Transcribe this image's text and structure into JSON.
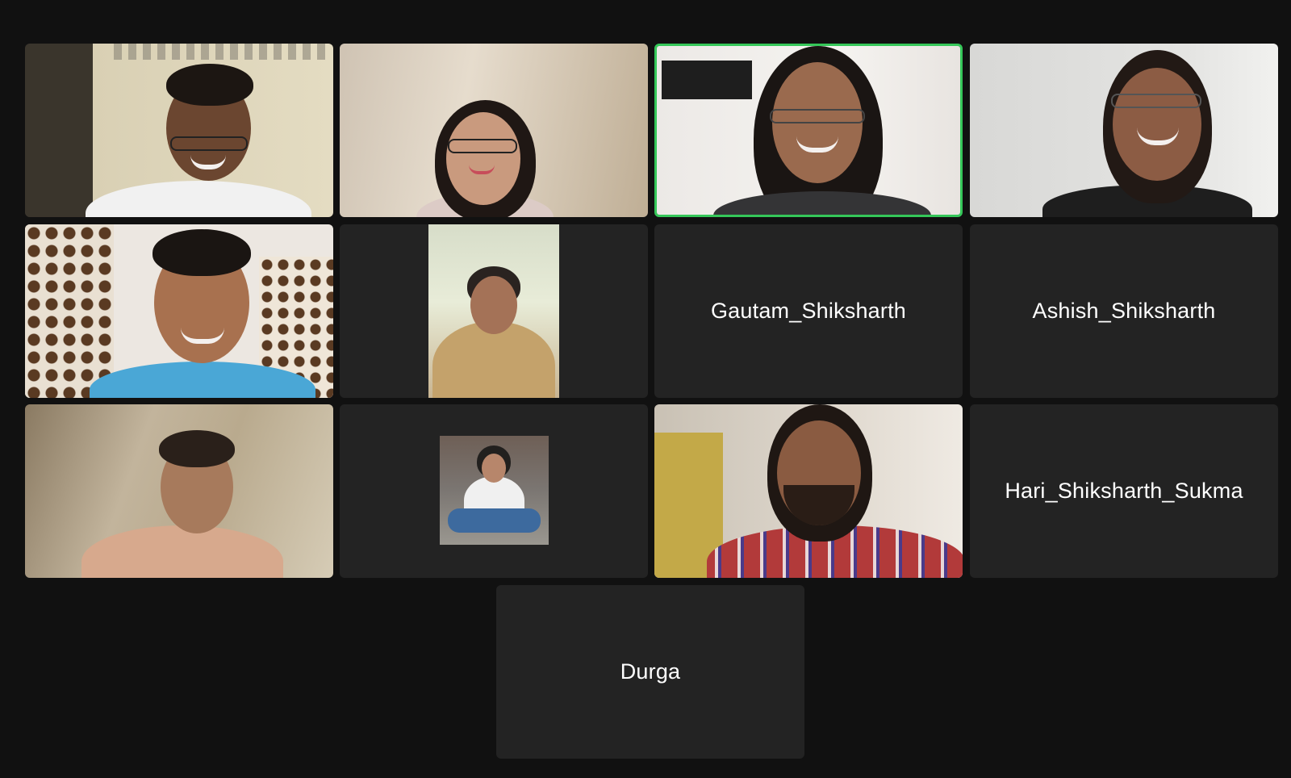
{
  "meeting": {
    "participants": [
      {
        "id": "p1",
        "video": true
      },
      {
        "id": "p2",
        "video": true
      },
      {
        "id": "p3",
        "video": true,
        "active_speaker": true
      },
      {
        "id": "p4",
        "video": true
      },
      {
        "id": "p5",
        "video": true
      },
      {
        "id": "p6",
        "video": false,
        "profile_photo": true
      },
      {
        "id": "p7",
        "video": false,
        "name": "Gautam_Shiksharth"
      },
      {
        "id": "p8",
        "video": false,
        "name": "Ashish_Shiksharth"
      },
      {
        "id": "p9",
        "video": true
      },
      {
        "id": "p10",
        "video": false,
        "profile_photo": true
      },
      {
        "id": "p11",
        "video": true
      },
      {
        "id": "p12",
        "video": false,
        "name": "Hari_Shiksharth_Sukma"
      },
      {
        "id": "p13",
        "video": false,
        "name": "Durga"
      }
    ]
  },
  "colors": {
    "background": "#111111",
    "tile": "#232323",
    "active_speaker_border": "#35c759",
    "name_text": "#ffffff"
  }
}
